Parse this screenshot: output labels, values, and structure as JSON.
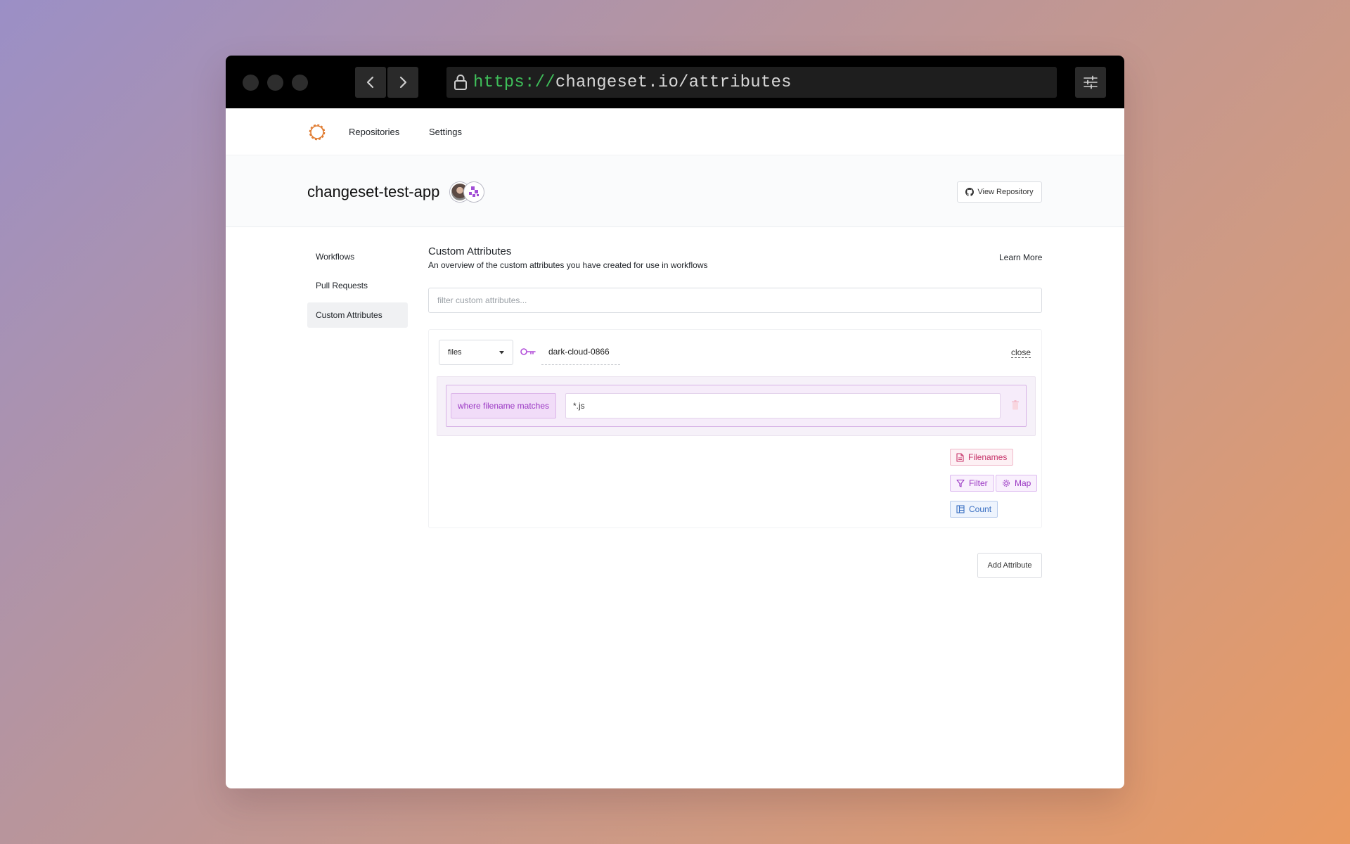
{
  "browser": {
    "url_scheme": "https://",
    "url_rest": "changeset.io/attributes"
  },
  "topnav": {
    "repositories": "Repositories",
    "settings": "Settings"
  },
  "repo": {
    "title": "changeset-test-app",
    "view_repository": "View Repository"
  },
  "sidebar": {
    "items": [
      {
        "label": "Workflows"
      },
      {
        "label": "Pull Requests"
      },
      {
        "label": "Custom Attributes"
      }
    ]
  },
  "main": {
    "title": "Custom Attributes",
    "subtitle": "An overview of the custom attributes you have created for use in workflows",
    "learn_more": "Learn More",
    "filter_placeholder": "filter custom attributes..."
  },
  "attribute": {
    "source": "files",
    "name": "dark-cloud-0866",
    "close": "close",
    "rule_label": "where filename matches",
    "rule_value": "*.js"
  },
  "operations": {
    "filenames": "Filenames",
    "filter": "Filter",
    "map": "Map",
    "count": "Count"
  },
  "actions": {
    "add_attribute": "Add Attribute"
  },
  "colors": {
    "accent_purple": "#9a37c3",
    "accent_pink": "#c7346a",
    "accent_blue": "#3a6fc2",
    "logo_orange": "#e07a2e",
    "url_green": "#3fbf5a"
  }
}
